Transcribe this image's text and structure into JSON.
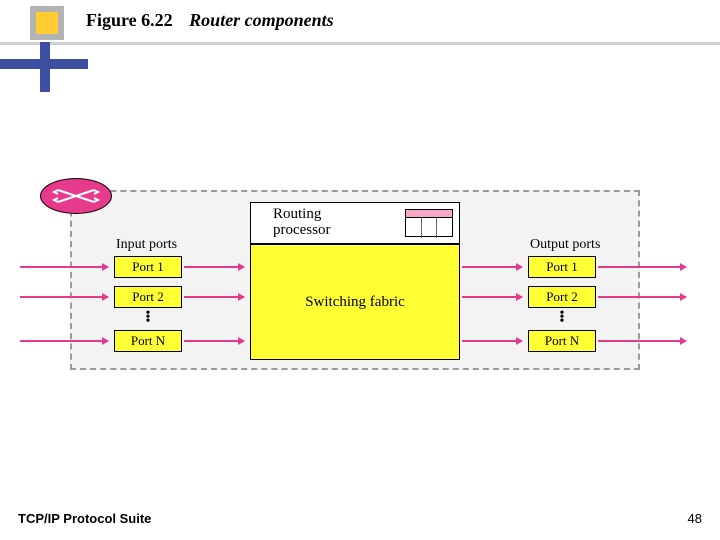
{
  "header": {
    "figure_number": "Figure 6.22",
    "figure_caption": "Router components"
  },
  "diagram": {
    "input_label": "Input ports",
    "output_label": "Output ports",
    "routing_processor": "Routing\nprocessor",
    "switching_fabric": "Switching fabric",
    "input_ports": [
      "Port 1",
      "Port 2",
      "Port N"
    ],
    "output_ports": [
      "Port 1",
      "Port 2",
      "Port N"
    ]
  },
  "footer": {
    "suite": "TCP/IP Protocol Suite",
    "page": "48"
  }
}
